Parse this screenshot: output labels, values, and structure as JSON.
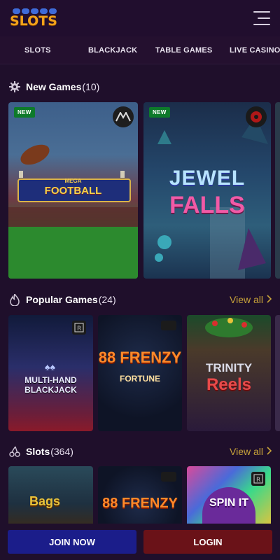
{
  "header": {
    "logo_text": "SLOTS",
    "menu_icon": "hamburger-icon"
  },
  "nav": {
    "items": [
      "SLOTS",
      "BLACKJACK",
      "TABLE GAMES",
      "LIVE CASINO"
    ]
  },
  "sections": {
    "new_games": {
      "title": "New Games",
      "count": "(10)",
      "icon": "gear-icon"
    },
    "popular_games": {
      "title": "Popular Games",
      "count": "(24)",
      "icon": "flame-icon",
      "view_all": "View all"
    },
    "slots": {
      "title": "Slots",
      "count": "(364)",
      "icon": "cherry-icon",
      "view_all": "View all"
    }
  },
  "new_games": [
    {
      "badge": "NEW",
      "title": "FOOTBALL",
      "subtitle": "MEGA"
    },
    {
      "badge": "NEW",
      "title": "JEWEL",
      "subtitle": "FALLS"
    }
  ],
  "popular_games": [
    {
      "title": "MULTI-HAND",
      "subtitle": "BLACKJACK"
    },
    {
      "title": "88 FRENZY",
      "subtitle": "FORTUNE"
    },
    {
      "title": "TRINITY",
      "subtitle": "Reels"
    }
  ],
  "slots_games": [
    {
      "title": "Bags"
    },
    {
      "title": "88 FRENZY"
    },
    {
      "title": "SPIN IT"
    }
  ],
  "footer": {
    "join_label": "JOIN NOW",
    "login_label": "LOGIN"
  },
  "colors": {
    "accent_gold": "#c8a33a",
    "join_blue": "#1b1d8a",
    "login_red": "#6a1218",
    "badge_green": "#0d7a2a"
  }
}
